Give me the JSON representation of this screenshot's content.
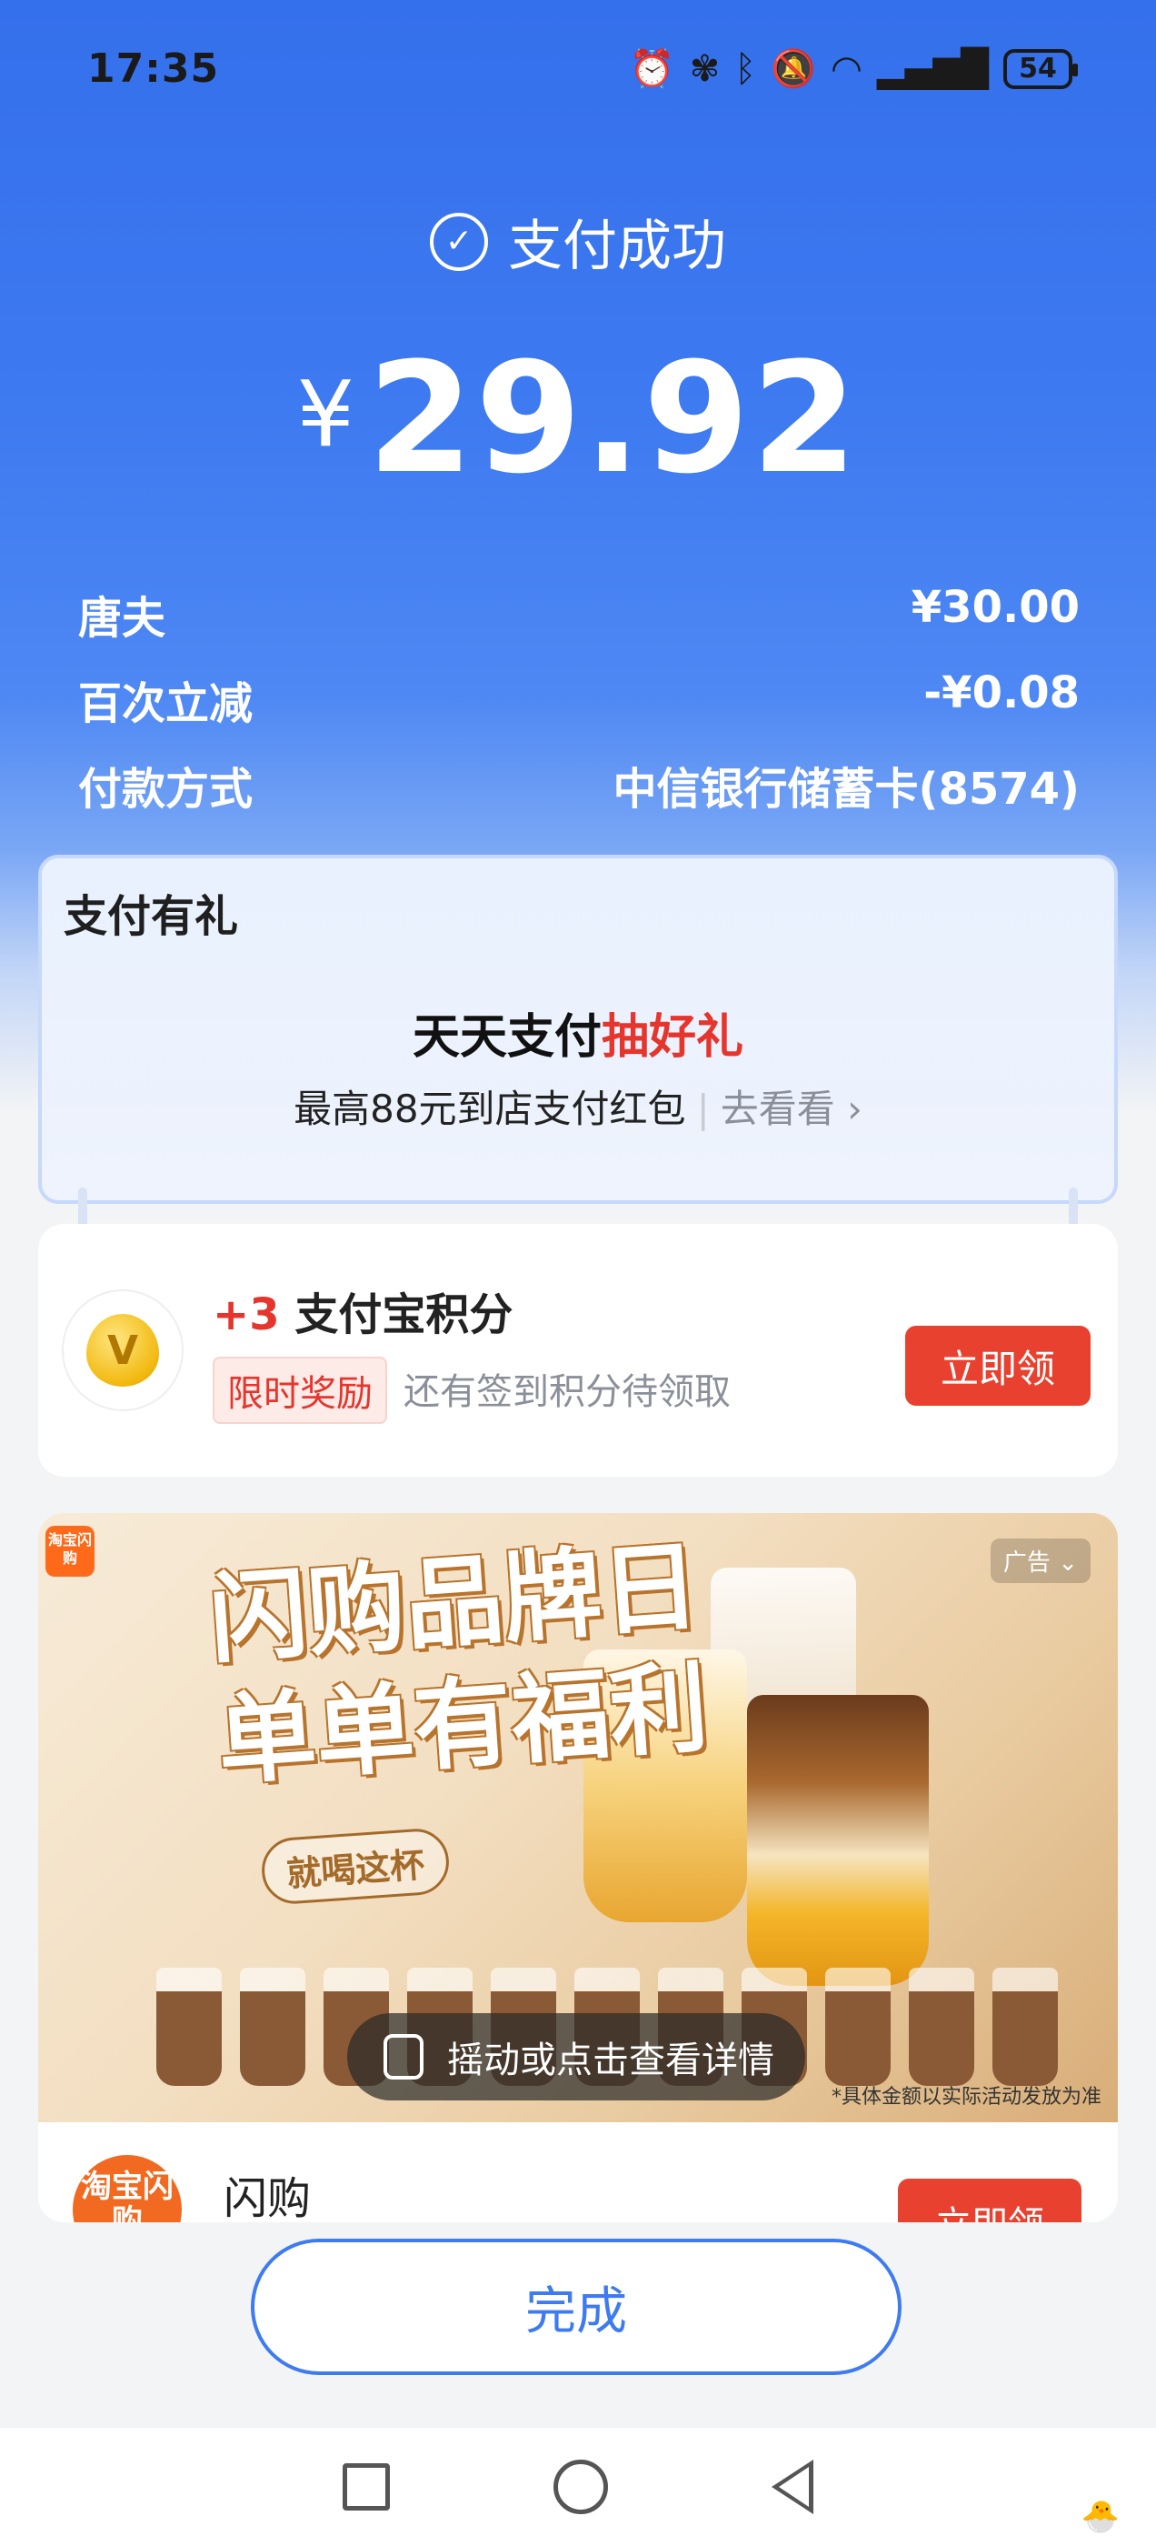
{
  "status_bar": {
    "time": "17:35",
    "icons": [
      "alarm-icon",
      "fan-icon",
      "bluetooth-icon",
      "mute-icon",
      "wifi-icon",
      "signal-5g-icon"
    ],
    "battery": "54"
  },
  "header": {
    "title": "支付成功",
    "currency": "¥",
    "amount": "29.92"
  },
  "details": [
    {
      "label": "唐夫",
      "value": "¥30.00"
    },
    {
      "label": "百次立减",
      "value": "-¥0.08"
    },
    {
      "label": "付款方式",
      "value": "中信银行储蓄卡(8574)"
    }
  ],
  "gift": {
    "title": "支付有礼",
    "main_black": "天天支付",
    "main_red": "抽好礼",
    "sub": "最高88元到店支付红包",
    "link": "去看看"
  },
  "points": {
    "plus": "+3",
    "title": "支付宝积分",
    "tag": "限时奖励",
    "note": "还有签到积分待领取",
    "button": "立即领"
  },
  "ad": {
    "logo_small": "淘宝闪购",
    "badge": "广告",
    "headline_line1": "闪购品牌日",
    "headline_line2": "单单有福利",
    "pill": "就喝这杯",
    "shake": "摇动或点击查看详情",
    "disclaimer": "*具体金额以实际活动发放为准",
    "brand_logo": "淘宝闪购",
    "brand_name": "闪购",
    "brand_button": "立即领"
  },
  "done_button": "完成",
  "colors": {
    "primary_blue": "#3570ec",
    "accent_red": "#e8412f"
  }
}
